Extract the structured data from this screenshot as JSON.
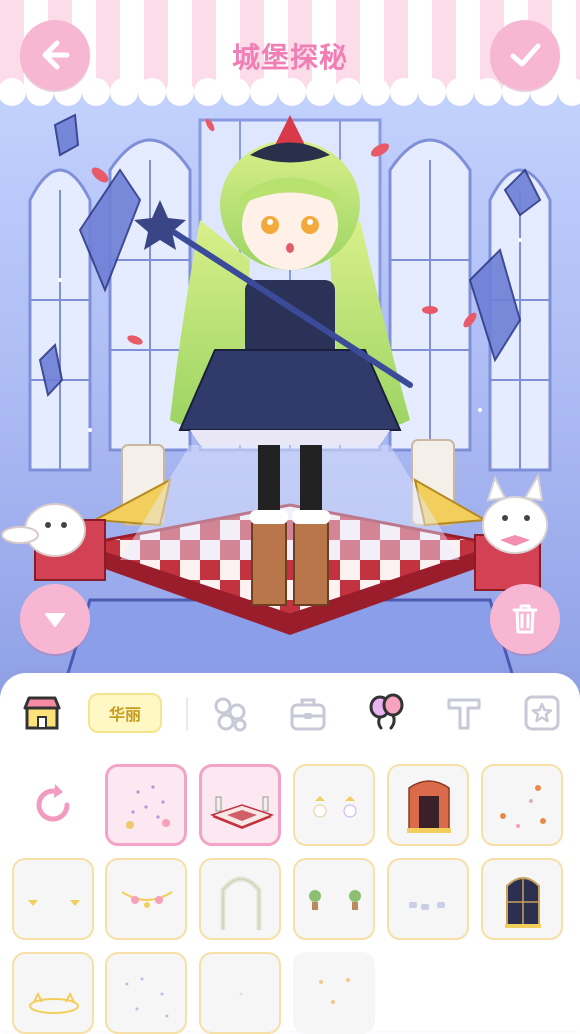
{
  "header": {
    "title": "城堡探秘",
    "back_icon": "arrow-left-icon",
    "confirm_icon": "check-icon"
  },
  "scene": {
    "collapse_icon": "triangle-down-icon",
    "delete_icon": "trash-icon"
  },
  "categories": [
    {
      "icon": "shop-icon"
    },
    {
      "label": "华丽"
    },
    {
      "icon": "flower-icon"
    },
    {
      "icon": "bag-icon"
    },
    {
      "icon": "balloons-icon",
      "selected": true
    },
    {
      "icon": "text-t-icon"
    },
    {
      "icon": "star-box-icon"
    }
  ],
  "items": [
    {
      "icon": "reset-icon"
    },
    {
      "name": "sparkle-flowers",
      "selected": true
    },
    {
      "name": "heart-checker-stage",
      "selected": true
    },
    {
      "name": "crown-dolls"
    },
    {
      "name": "theater-curtain"
    },
    {
      "name": "floral-scatter"
    },
    {
      "name": "golden-lamps"
    },
    {
      "name": "flower-garland"
    },
    {
      "name": "rose-arch"
    },
    {
      "name": "potted-trees"
    },
    {
      "name": "tea-cups"
    },
    {
      "name": "night-window"
    },
    {
      "name": "golden-crown-base"
    },
    {
      "name": "star-dust"
    },
    {
      "name": "faint-sparkles"
    },
    {
      "name": "pink-sparkles"
    }
  ],
  "colors": {
    "accent_pink": "#f7b7d2",
    "title_pink": "#f17fb5",
    "pill_yellow": "#fff7c4",
    "selected_border": "#f2a3c6",
    "item_border": "#f6e0a6"
  }
}
